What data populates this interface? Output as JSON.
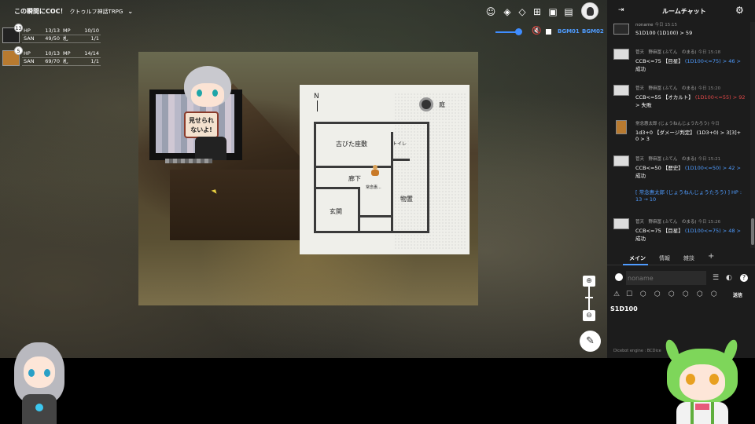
{
  "topbar": {
    "room_title": "この瞬間にCOC！",
    "room_subtitle": "クトゥルフ神話TRPG",
    "icons": [
      "face-icon",
      "layers-icon",
      "stack-icon",
      "add-card-icon",
      "screen-icon",
      "movie-icon"
    ]
  },
  "audio": {
    "bgm1": "BGM01",
    "bgm2": "BGM02",
    "volume_fraction": 0.8
  },
  "characters": [
    {
      "badge": "13",
      "hp_label": "HP",
      "hp": "13/13",
      "mp_label": "MP",
      "mp": "10/10",
      "san_label": "SAN",
      "san": "49/50",
      "extra_label": "札",
      "extra": "1/1"
    },
    {
      "badge": "5",
      "hp_label": "HP",
      "hp": "10/13",
      "mp_label": "MP",
      "mp": "14/14",
      "san_label": "SAN",
      "san": "69/70",
      "extra_label": "札",
      "extra": "1/1"
    }
  ],
  "board": {
    "chip_sign_line1": "見せられ",
    "chip_sign_line2": "ないよ!",
    "plan": {
      "north": "N",
      "garden": "庭",
      "room_main": "古びた座敷",
      "room_toilet": "トイレ",
      "room_hall": "廊下",
      "room_entrance": "玄関",
      "room_storage": "物置",
      "token_label": "常念惠..."
    }
  },
  "chat": {
    "title": "ルームチャット",
    "messages": [
      {
        "name": "noname",
        "time": "今日 15:15",
        "lines": [
          [
            {
              "t": "S1D100 (1D100) > 59",
              "c": ""
            }
          ]
        ]
      },
      {
        "name": "菅天　野麻冨 (ふてん　のまる)",
        "time": "今日 15:18",
        "lines": [
          [
            {
              "t": "CCB<=75 【目星】 ",
              "c": ""
            },
            {
              "t": "(1D100<=75) > 46 >",
              "c": "blue"
            }
          ],
          [
            {
              "t": "成功",
              "c": "blue"
            }
          ]
        ]
      },
      {
        "name": "菅天　野麻冨 (ふてん　のまる)",
        "time": "今日 15:20",
        "lines": [
          [
            {
              "t": "CCB<=55 【オカルト】 ",
              "c": ""
            },
            {
              "t": "(1D100<=55) > 92",
              "c": "red"
            }
          ],
          [
            {
              "t": "> 失敗",
              "c": "red"
            }
          ]
        ]
      },
      {
        "name": "常念惠太郎 (じょうねんじょうたろう)",
        "time": "今日",
        "lines": [
          [
            {
              "t": "1d3+0 【ダメージ判定】 (1D3+0) > 3[3]+",
              "c": ""
            }
          ],
          [
            {
              "t": "0 > 3",
              "c": ""
            }
          ]
        ]
      },
      {
        "name": "菅天　野麻冨 (ふてん　のまる)",
        "time": "今日 15:21",
        "lines": [
          [
            {
              "t": "CCB<=50 【歴史】 ",
              "c": ""
            },
            {
              "t": "(1D100<=50) > 42 >",
              "c": "blue"
            }
          ],
          [
            {
              "t": "成功",
              "c": "blue"
            }
          ]
        ]
      },
      {
        "system": "[ 常念惠太郎 (じょうねんじょうたろう) ] HP : 13 → 10"
      },
      {
        "name": "菅天　野麻冨 (ふてん　のまる)",
        "time": "今日 15:26",
        "lines": [
          [
            {
              "t": "CCB<=75 【目星】 ",
              "c": ""
            },
            {
              "t": "(1D100<=75) > 48 >",
              "c": "blue"
            }
          ],
          [
            {
              "t": "成功",
              "c": "blue"
            }
          ]
        ]
      }
    ],
    "tabs": [
      "メイン",
      "情報",
      "雑談"
    ],
    "add_tab": "+",
    "name_placeholder": "noname",
    "send_label": "送信",
    "input_text": "S1D100",
    "dicebot": "Dicebot engine : BCDice"
  }
}
